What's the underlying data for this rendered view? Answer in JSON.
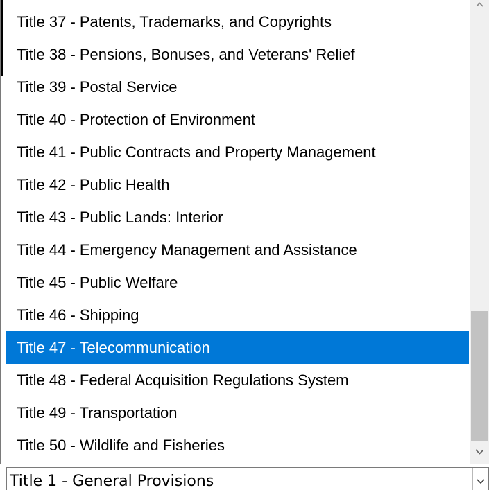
{
  "list": {
    "options": [
      "Title 37 - Patents, Trademarks, and Copyrights",
      "Title 38 - Pensions, Bonuses, and Veterans' Relief",
      "Title 39 - Postal Service",
      "Title 40 - Protection of Environment",
      "Title 41 - Public Contracts and Property Management",
      "Title 42 - Public Health",
      "Title 43 - Public Lands: Interior",
      "Title 44 - Emergency Management and Assistance",
      "Title 45 - Public Welfare",
      "Title 46 - Shipping",
      "Title 47 - Telecommunication",
      "Title 48 - Federal Acquisition Regulations System",
      "Title 49 - Transportation",
      "Title 50 - Wildlife and Fisheries"
    ],
    "highlighted": "Title 47 - Telecommunication"
  },
  "combo": {
    "value": "Title 1 - General Provisions"
  },
  "icons": {
    "scroll_up": "chevron-up-icon",
    "scroll_down": "chevron-down-icon",
    "combo_arrow": "chevron-down-icon"
  },
  "colors": {
    "highlight": "#0078d7",
    "scroll_thumb": "#c2c2c2",
    "scroll_track": "#f0f0f0"
  }
}
